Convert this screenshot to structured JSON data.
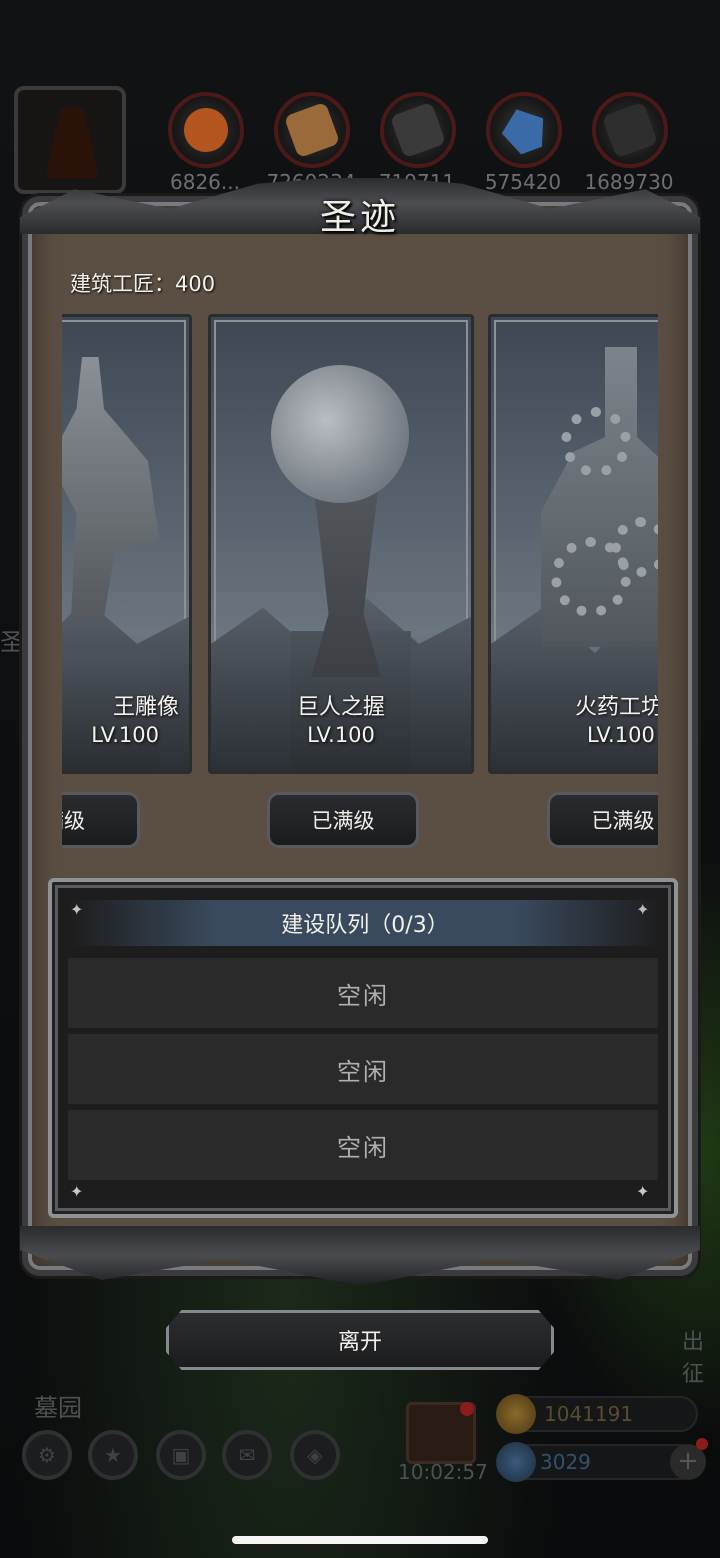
{
  "title": "圣迹",
  "workers_label": "建筑工匠：400",
  "resources": [
    "6826...",
    "7260234",
    "719711",
    "575420",
    "1689730"
  ],
  "resource_colors": [
    "#b5551f",
    "#9a6a3a",
    "#3a3a3a",
    "#3a6aa8",
    "#2e2e2e"
  ],
  "cards": [
    {
      "name": "王雕像",
      "level": "LV.100",
      "button": "满级"
    },
    {
      "name": "巨人之握",
      "level": "LV.100",
      "button": "已满级"
    },
    {
      "name": "火药工坊",
      "level": "LV.100",
      "button": "已满级"
    }
  ],
  "queue": {
    "title": "建设队列（0/3）",
    "slots": [
      "空闲",
      "空闲",
      "空闲"
    ]
  },
  "leave_label": "离开",
  "background_ui": {
    "side_text": "圣迹",
    "march_label": "出征",
    "location": "墓园",
    "timer": "10:02:57",
    "gold": "1041191",
    "gems": "3029"
  },
  "icons": [
    "gear-icon",
    "star-icon",
    "chest-icon",
    "mail-icon",
    "map-icon",
    "gift-icon",
    "plus-icon"
  ]
}
